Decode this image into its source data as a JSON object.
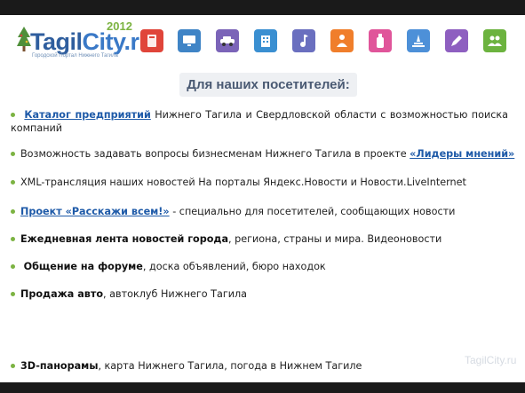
{
  "logo": {
    "tagil": "Tagil",
    "city": "City.ru",
    "year": "2012",
    "subtitle": "Городской Портал Нижнего Тагила"
  },
  "icons": [
    {
      "name": "book-icon",
      "color": "#e0453a"
    },
    {
      "name": "computer-icon",
      "color": "#3f84c6"
    },
    {
      "name": "car-icon",
      "color": "#7b64b8"
    },
    {
      "name": "building-icon",
      "color": "#3a8fd1"
    },
    {
      "name": "music-icon",
      "color": "#6a6fbf"
    },
    {
      "name": "person-icon",
      "color": "#f07e2b"
    },
    {
      "name": "drink-icon",
      "color": "#e0559a"
    },
    {
      "name": "monument-icon",
      "color": "#4d90d8"
    },
    {
      "name": "pen-icon",
      "color": "#8e5fc0"
    },
    {
      "name": "people-icon",
      "color": "#6cb33f"
    }
  ],
  "header": "Для наших посетителей:",
  "items": {
    "i1_link": "Каталог предприятий",
    "i1_rest": " Нижнего Тагила и Свердловской области с возможностью поиска компаний",
    "i2_text": "Возможность задавать вопросы бизнесменам Нижнего Тагила в проекте ",
    "i2_link": "«Лидеры мнений»",
    "i3_text": "XML-трансляция наших новостей На порталы Яндекс.Новости и Новости.LiveInternet",
    "i4_link": "Проект «Расскажи всем!»",
    "i4_rest": " - специально для посетителей, сообщающих новости",
    "i5_bold": "Ежедневная лента новостей города",
    "i5_rest": ", региона, страны и мира. Видеоновости",
    "i6_bold": "Общение на форуме",
    "i6_rest": ", доска объявлений, бюро находок",
    "i7_bold": "Продажа авто",
    "i7_rest": ", автоклуб Нижнего Тагила",
    "i8_bold": "3D-панорамы",
    "i8_rest": ", карта Нижнего Тагила, погода в Нижнем Тагиле"
  },
  "watermark": "TagilCity.ru"
}
